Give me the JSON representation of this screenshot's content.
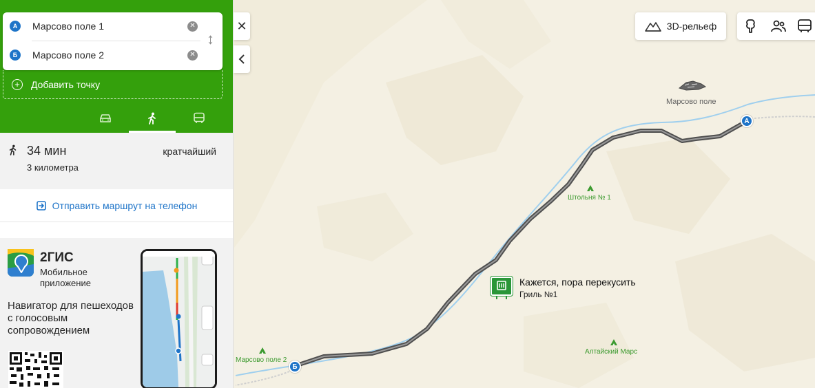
{
  "route": {
    "from": {
      "badge": "А",
      "text": "Марсово поле 1"
    },
    "to": {
      "badge": "Б",
      "text": "Марсово поле 2"
    },
    "add_point": "Добавить точку"
  },
  "summary": {
    "time": "34 мин",
    "distance": "3 километра",
    "tag": "кратчайший"
  },
  "send_route": "Отправить маршрут на телефон",
  "promo": {
    "title": "2ГИС",
    "subtitle": "Мобильное приложение",
    "description": "Навигатор для пешеходов с голосовым сопровождением"
  },
  "map": {
    "relief_label": "3D-рельеф",
    "labels": {
      "marsovo_pole": "Марсово поле",
      "shtolnya": "Штольня № 1",
      "marsovo_pole_2": "Марсово поле 2",
      "altai_mars": "Алтайский Марс"
    },
    "pins": {
      "a": "А",
      "b": "Б"
    },
    "food": {
      "title": "Кажется, пора перекусить",
      "subtitle": "Гриль №1"
    }
  },
  "colors": {
    "brand_green": "#34a00c",
    "route_blue": "#1e74c8",
    "route_line": "#5a5a5a"
  }
}
